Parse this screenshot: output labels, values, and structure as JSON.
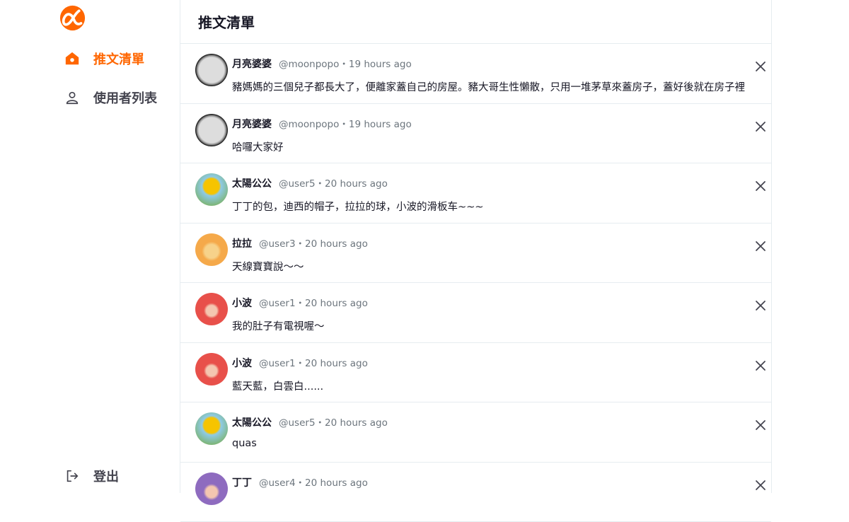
{
  "colors": {
    "accent": "#FF6600",
    "border": "#e6ecf0"
  },
  "sidebar": {
    "logo_icon": "alpha-logo-icon",
    "items": [
      {
        "label": "推文清單",
        "icon": "home-icon",
        "active": true
      },
      {
        "label": "使用者列表",
        "icon": "user-icon",
        "active": false
      }
    ],
    "logout": {
      "label": "登出",
      "icon": "logout-icon"
    }
  },
  "header": {
    "title": "推文清單"
  },
  "tweets": [
    {
      "name": "月亮婆婆",
      "handle": "@moonpopo・19 hours ago",
      "text": "豬媽媽的三個兒子都長大了，便離家蓋自己的房屋。豬大哥生性懶散，只用一堆茅草來蓋房子，蓋好後就在房子裡",
      "avatar": "moon"
    },
    {
      "name": "月亮婆婆",
      "handle": "@moonpopo・19 hours ago",
      "text": "哈囉大家好",
      "avatar": "moon"
    },
    {
      "name": "太陽公公",
      "handle": "@user5・20 hours ago",
      "text": "丁丁的包，迪西的帽子，拉拉的球，小波的滑板车~~~",
      "avatar": "sun"
    },
    {
      "name": "拉拉",
      "handle": "@user3・20 hours ago",
      "text": "天線寶寶說〜〜",
      "avatar": "laa"
    },
    {
      "name": "小波",
      "handle": "@user1・20 hours ago",
      "text": "我的肚子有電視喔〜",
      "avatar": "po"
    },
    {
      "name": "小波",
      "handle": "@user1・20 hours ago",
      "text": "藍天藍，白雲白......",
      "avatar": "po"
    },
    {
      "name": "太陽公公",
      "handle": "@user5・20 hours ago",
      "text": "quas",
      "avatar": "sun"
    },
    {
      "name": "丁丁",
      "handle": "@user4・20 hours ago",
      "text": "",
      "avatar": "tinky"
    }
  ]
}
